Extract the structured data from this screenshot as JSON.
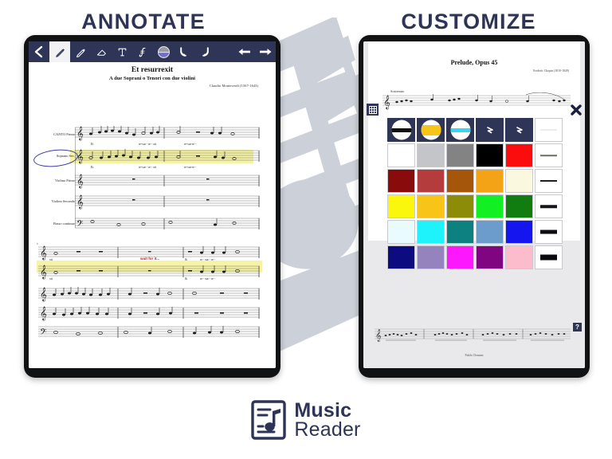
{
  "brand": {
    "name_line1": "Music",
    "name_line2": "Reader",
    "logo_icon": "music-sheet-note-icon",
    "accent_navy": "#2d3456",
    "watermark_gray": "#ccd0d8"
  },
  "headings": {
    "left": "ANNOTATE",
    "right": "CUSTOMIZE"
  },
  "left_tablet": {
    "device": "tablet-landscape",
    "toolbar": {
      "items": [
        {
          "name": "back-chevron-icon",
          "label": "Back",
          "active": false
        },
        {
          "name": "pencil-icon",
          "label": "Pen",
          "active": true
        },
        {
          "name": "highlighter-icon",
          "label": "Highlighter",
          "active": false
        },
        {
          "name": "eraser-icon",
          "label": "Eraser",
          "active": false
        },
        {
          "name": "text-tool-icon",
          "label": "Text",
          "active": false
        },
        {
          "name": "slur-tool-icon",
          "label": "Slur",
          "active": false
        },
        {
          "name": "color-circle-icon",
          "label": "Color",
          "active": false
        },
        {
          "name": "undo-icon",
          "label": "Undo",
          "active": false
        },
        {
          "name": "redo-icon",
          "label": "Redo",
          "active": false
        },
        {
          "name": "previous-page-arrow-icon",
          "label": "Previous page",
          "active": false
        },
        {
          "name": "next-page-arrow-icon",
          "label": "Next page",
          "active": false
        }
      ]
    },
    "score": {
      "title": "Et resurrexit",
      "subtitle": "A due Soprani o Tenori con due violini",
      "composer": "Claudio Monteverdi (1567-1643)",
      "staff_labels": [
        "CANTO Primo",
        "Soprano Sec.",
        "Violino Primo",
        "Violino Secondo",
        "Basso continuo"
      ],
      "lyrics_system1": [
        "Et",
        "re-sur - re - xit",
        "re-sur-re  -"
      ],
      "lyrics_system2": [
        "xit",
        "&",
        "re - sur - re  -"
      ],
      "annotation_text": "wait for it...",
      "annotation_color": "#cc2222",
      "highlight_color": "#f4f08a",
      "circle_color": "#3c3ba8",
      "system2_measure_number": "5"
    }
  },
  "right_tablet": {
    "device": "tablet-portrait",
    "score": {
      "title": "Prelude, Opus 45",
      "composer": "Frederic Chopin (1810-1849)",
      "tempo": "Sostenuto",
      "footer": "Public Domain"
    },
    "overlay": {
      "grid_button": "grid-icon",
      "close_button": "close-x-icon",
      "help_button": "?"
    },
    "palette": {
      "columns": 6,
      "rows": [
        {
          "kind": "tools",
          "cells": [
            {
              "type": "circle-band",
              "label": "Black pen",
              "color": "#111111",
              "band_height": 5
            },
            {
              "type": "circle-band",
              "label": "Yellow highlighter",
              "color": "#f5c518",
              "band_height": 13
            },
            {
              "type": "circle-band",
              "label": "Cyan highlighter",
              "color": "#35d8f0",
              "band_height": 5
            },
            {
              "type": "mark",
              "label": "Eraser small",
              "color": "#ffffff"
            },
            {
              "type": "mark",
              "label": "Eraser large",
              "color": "#ffffff"
            },
            {
              "type": "linewidth",
              "label": "Line width 1",
              "color": "#d8d8dc",
              "thickness": 1
            }
          ]
        },
        {
          "kind": "colors",
          "cells": [
            {
              "type": "color",
              "label": "White",
              "color": "#ffffff"
            },
            {
              "type": "color",
              "label": "Light gray",
              "color": "#c3c5c9"
            },
            {
              "type": "color",
              "label": "Gray",
              "color": "#838383"
            },
            {
              "type": "color",
              "label": "Black",
              "color": "#000000"
            },
            {
              "type": "color",
              "label": "Red",
              "color": "#fc0d0d"
            },
            {
              "type": "linewidth",
              "label": "Line width 2",
              "color": "#6e6a62",
              "thickness": 1.5
            }
          ]
        },
        {
          "kind": "colors",
          "cells": [
            {
              "type": "color",
              "label": "Dark red",
              "color": "#8a0b0b"
            },
            {
              "type": "color",
              "label": "Brick",
              "color": "#b53c3c"
            },
            {
              "type": "color",
              "label": "Brown",
              "color": "#a5560b"
            },
            {
              "type": "color",
              "label": "Orange",
              "color": "#f5a316"
            },
            {
              "type": "color",
              "label": "Cream",
              "color": "#fbf8e0"
            },
            {
              "type": "linewidth",
              "label": "Line width 3",
              "color": "#1d1d22",
              "thickness": 2
            }
          ]
        },
        {
          "kind": "colors",
          "cells": [
            {
              "type": "color",
              "label": "Yellow",
              "color": "#faf70c"
            },
            {
              "type": "color",
              "label": "Gold",
              "color": "#f7c417"
            },
            {
              "type": "color",
              "label": "Olive",
              "color": "#8d8c09"
            },
            {
              "type": "color",
              "label": "Bright green",
              "color": "#12ef22"
            },
            {
              "type": "color",
              "label": "Green",
              "color": "#117d11"
            },
            {
              "type": "linewidth",
              "label": "Line width 4",
              "color": "#15151a",
              "thickness": 3.5
            }
          ]
        },
        {
          "kind": "colors",
          "cells": [
            {
              "type": "color",
              "label": "Ice blue",
              "color": "#eafbfe"
            },
            {
              "type": "color",
              "label": "Cyan",
              "color": "#1ef3fb"
            },
            {
              "type": "color",
              "label": "Teal",
              "color": "#0d8080"
            },
            {
              "type": "color",
              "label": "Steel blue",
              "color": "#6b9ccb"
            },
            {
              "type": "color",
              "label": "Blue",
              "color": "#1515f0"
            },
            {
              "type": "linewidth",
              "label": "Line width 5",
              "color": "#0d0d11",
              "thickness": 5
            }
          ]
        },
        {
          "kind": "colors",
          "cells": [
            {
              "type": "color",
              "label": "Navy",
              "color": "#0c0c80"
            },
            {
              "type": "color",
              "label": "Lavender",
              "color": "#9483bd"
            },
            {
              "type": "color",
              "label": "Magenta",
              "color": "#fd17fd"
            },
            {
              "type": "color",
              "label": "Purple",
              "color": "#800580"
            },
            {
              "type": "color",
              "label": "Pink",
              "color": "#fcbccb"
            },
            {
              "type": "linewidth",
              "label": "Line width 6",
              "color": "#0a0a0e",
              "thickness": 7
            }
          ]
        }
      ]
    }
  }
}
